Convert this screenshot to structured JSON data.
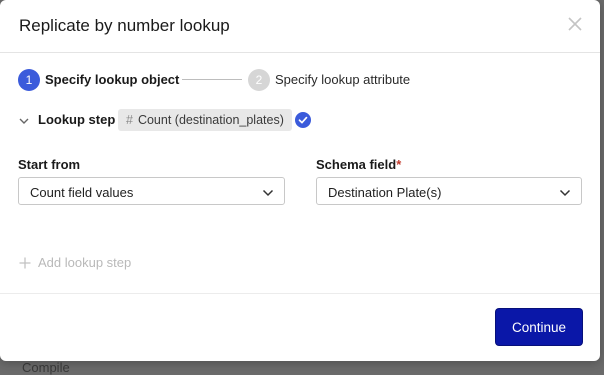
{
  "dialog": {
    "title": "Replicate by number lookup"
  },
  "stepper": {
    "steps": [
      {
        "number": "1",
        "label": "Specify lookup object",
        "state": "active"
      },
      {
        "number": "2",
        "label": "Specify lookup attribute",
        "state": "inactive"
      }
    ]
  },
  "lookup": {
    "label": "Lookup step",
    "chip_icon": "#",
    "chip_text": "Count (destination_plates)"
  },
  "start_from": {
    "label": "Start from",
    "value": "Count field values"
  },
  "schema_field": {
    "label": "Schema field",
    "required_mark": "*",
    "value": "Destination Plate(s)"
  },
  "add_step": {
    "label": "Add lookup step"
  },
  "footer": {
    "continue_label": "Continue"
  },
  "colors": {
    "accent": "#3b5bdb",
    "primary_button": "#0a17a8",
    "required": "#c0392b"
  }
}
